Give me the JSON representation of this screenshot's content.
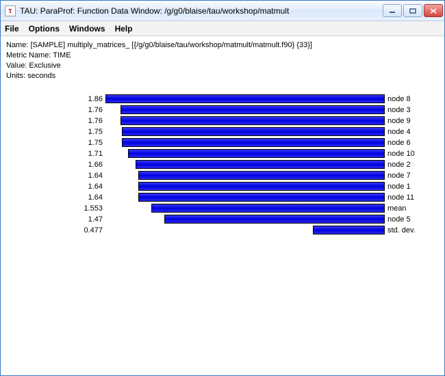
{
  "window": {
    "title": "TAU: ParaProf: Function Data Window: /g/g0/blaise/tau/workshop/matmult",
    "app_icon_glyph": "τ"
  },
  "menu": {
    "file": "File",
    "options": "Options",
    "windows": "Windows",
    "help": "Help"
  },
  "meta": {
    "name": "Name: [SAMPLE] multiply_matrices_ [{/g/g0/blaise/tau/workshop/matmult/matmult.f90} {33}]",
    "metric": "Metric Name: TIME",
    "value": "Value: Exclusive",
    "units": "Units: seconds"
  },
  "chart_data": {
    "type": "bar",
    "title": "",
    "xlabel": "",
    "ylabel": "",
    "ylim": [
      0,
      1.86
    ],
    "bar_color": "#0000e0",
    "series": [
      {
        "label": "node 8",
        "value": 1.86,
        "display": "1.86"
      },
      {
        "label": "node 3",
        "value": 1.76,
        "display": "1.76"
      },
      {
        "label": "node 9",
        "value": 1.76,
        "display": "1.76"
      },
      {
        "label": "node 4",
        "value": 1.75,
        "display": "1.75"
      },
      {
        "label": "node 6",
        "value": 1.75,
        "display": "1.75"
      },
      {
        "label": "node 10",
        "value": 1.71,
        "display": "1.71"
      },
      {
        "label": "node 2",
        "value": 1.66,
        "display": "1.66"
      },
      {
        "label": "node 7",
        "value": 1.64,
        "display": "1.64"
      },
      {
        "label": "node 1",
        "value": 1.64,
        "display": "1.64"
      },
      {
        "label": "node 11",
        "value": 1.64,
        "display": "1.64"
      },
      {
        "label": "mean",
        "value": 1.553,
        "display": "1.553"
      },
      {
        "label": "node 5",
        "value": 1.47,
        "display": "1.47"
      },
      {
        "label": "std. dev.",
        "value": 0.477,
        "display": "0.477"
      }
    ]
  }
}
